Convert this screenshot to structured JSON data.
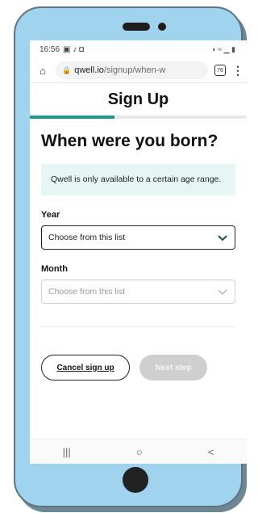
{
  "status_bar": {
    "time": "16:56",
    "left_icons": "▣ ♪ ◘",
    "right_icons": "◖ ≈ ▁ ▮"
  },
  "browser": {
    "url_host": "qwell.io",
    "url_path": "/signup/when-w",
    "tab_count": "76"
  },
  "page": {
    "header_title": "Sign Up",
    "progress_fraction": 0.39
  },
  "step": {
    "question": "When were you born?",
    "info_text": "Qwell is only available to a certain age range.",
    "year_label": "Year",
    "year_placeholder": "Choose from this list",
    "month_label": "Month",
    "month_placeholder": "Choose from this list"
  },
  "actions": {
    "cancel_label": "Cancel sign up",
    "next_label": "Next step"
  },
  "nav": {
    "recents": "|||",
    "home": "○",
    "back": "<"
  },
  "colors": {
    "accent": "#1a9b8c",
    "info_bg": "#e6f6f4",
    "phone_body": "#9fd3ee"
  }
}
